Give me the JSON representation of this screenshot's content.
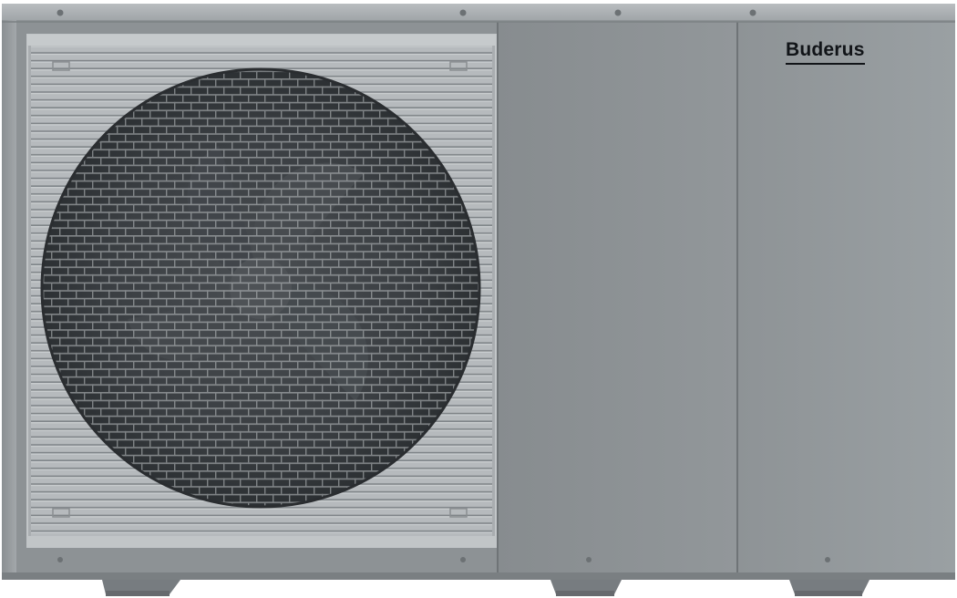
{
  "product": {
    "type": "outdoor air-to-water heat pump unit",
    "brand": "Buderus",
    "housing_color": "#8f9496",
    "grille_color": "#b2b6b8",
    "fan_color": "#3b3f43"
  },
  "icons": [
    "fan-icon",
    "screw-icon",
    "mounting-foot-icon"
  ]
}
